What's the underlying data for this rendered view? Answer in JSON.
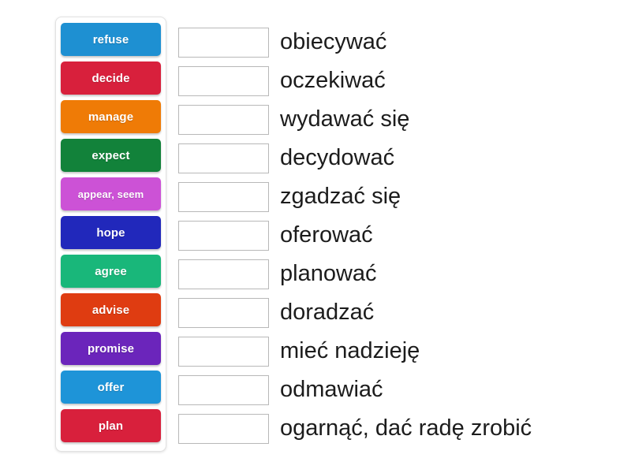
{
  "activity": {
    "tiles": [
      {
        "label": "refuse",
        "color": "#1e90d2"
      },
      {
        "label": "decide",
        "color": "#d8203c"
      },
      {
        "label": "manage",
        "color": "#ef7b06"
      },
      {
        "label": "expect",
        "color": "#12823a"
      },
      {
        "label": "appear, seem",
        "color": "#cc52d6"
      },
      {
        "label": "hope",
        "color": "#2128bb"
      },
      {
        "label": "agree",
        "color": "#19b77a"
      },
      {
        "label": "advise",
        "color": "#df3c11"
      },
      {
        "label": "promise",
        "color": "#6b25bb"
      },
      {
        "label": "offer",
        "color": "#1e94d8"
      },
      {
        "label": "plan",
        "color": "#d8203c"
      }
    ],
    "rows": [
      {
        "answer": "",
        "prompt": "obiecywać"
      },
      {
        "answer": "",
        "prompt": "oczekiwać"
      },
      {
        "answer": "",
        "prompt": "wydawać się"
      },
      {
        "answer": "",
        "prompt": "decydować"
      },
      {
        "answer": "",
        "prompt": "zgadzać się"
      },
      {
        "answer": "",
        "prompt": "oferować"
      },
      {
        "answer": "",
        "prompt": "planować"
      },
      {
        "answer": "",
        "prompt": "doradzać"
      },
      {
        "answer": "",
        "prompt": "mieć nadzieję"
      },
      {
        "answer": "",
        "prompt": "odmawiać"
      },
      {
        "answer": "",
        "prompt": "ogarnąć, dać radę zrobić"
      }
    ]
  }
}
